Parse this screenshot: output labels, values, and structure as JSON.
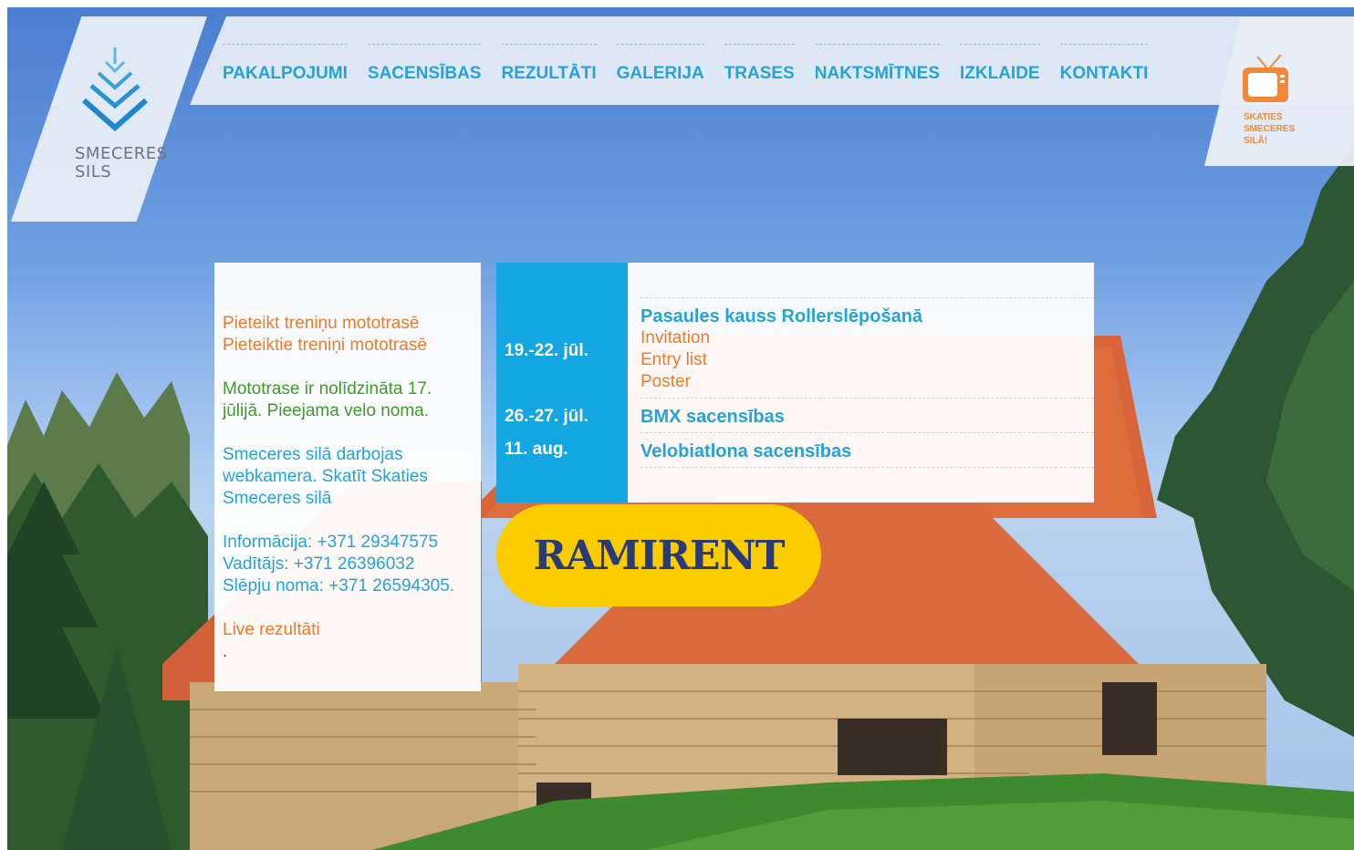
{
  "logo": {
    "line1": "SMECERES",
    "line2": "SILS"
  },
  "nav": [
    "PAKALPOJUMI",
    "SACENSĪBAS",
    "REZULTĀTI",
    "GALERIJA",
    "TRASES",
    "NAKTSMĪTNES",
    "IZKLAIDE",
    "KONTAKTI"
  ],
  "tv": {
    "icon": "tv-icon",
    "lines": [
      "SKATIES",
      "SMECERES",
      "SILĀ!"
    ]
  },
  "info": {
    "link1": "Pieteikt treniņu mototrasē",
    "link2": "Pieteiktie treniņi mototrasē",
    "notice": "Mototrase ir nolīdzināta 17. jūlijā. Pieejama velo noma.",
    "webcam": "Smeceres silā darbojas webkamera. Skatīt Skaties Smeceres silā",
    "phone_info": "Informācija: +371 29347575",
    "phone_manager": "Vadītājs: +371 26396032",
    "phone_ski": "Slēpju noma: +371 26594305.",
    "live": "Live rezultāti",
    "dot": "."
  },
  "events": [
    {
      "date": "19.-22. jūl.",
      "title": "Pasaules kauss Rollerslēpošanā",
      "links": [
        "Invitation",
        "Entry list",
        "Poster"
      ]
    },
    {
      "date": "26.-27. jūl.",
      "title": "BMX sacensības",
      "links": []
    },
    {
      "date": "11. aug.",
      "title": "Velobiatlona sacensības",
      "links": []
    }
  ],
  "sponsor": {
    "label": "RAMIRENT",
    "color": "#fbcc00"
  },
  "colors": {
    "accent": "#24a3d9",
    "orange": "#f07a2a",
    "green": "#3f9a2a",
    "date_bg": "#13a6e0"
  }
}
